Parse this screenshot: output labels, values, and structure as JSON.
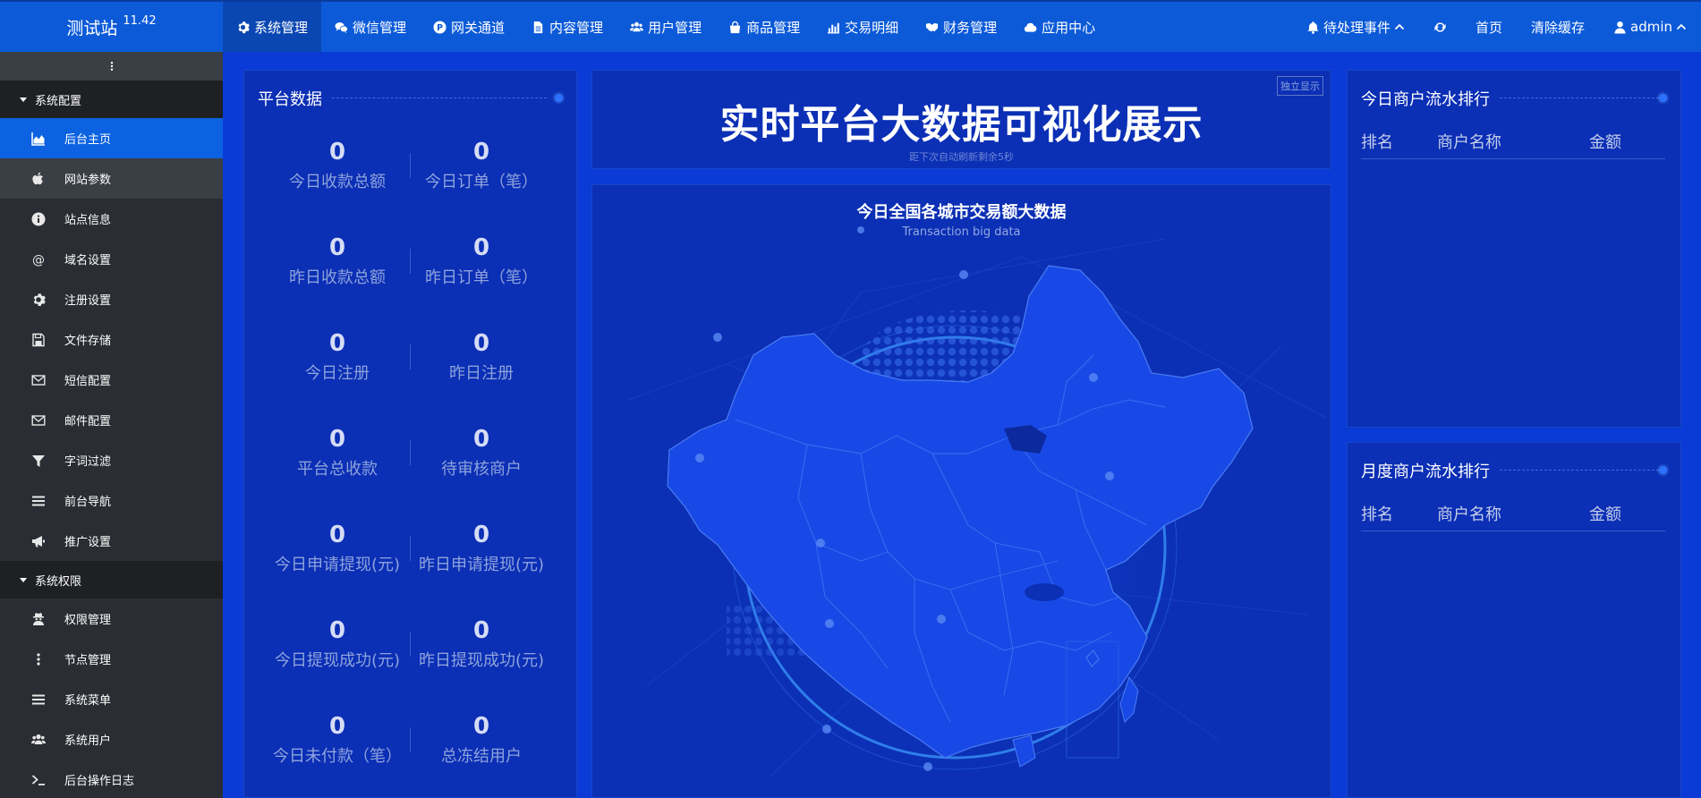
{
  "brand": {
    "name": "测试站",
    "version": "11.42"
  },
  "topnav": [
    {
      "label": "系统管理",
      "icon": "gear-icon",
      "active": true
    },
    {
      "label": "微信管理",
      "icon": "wechat-icon",
      "active": false
    },
    {
      "label": "网关通道",
      "icon": "paypal-icon",
      "active": false
    },
    {
      "label": "内容管理",
      "icon": "file-icon",
      "active": false
    },
    {
      "label": "用户管理",
      "icon": "users-icon",
      "active": false
    },
    {
      "label": "商品管理",
      "icon": "shopping-bag-icon",
      "active": false
    },
    {
      "label": "交易明细",
      "icon": "bar-chart-icon",
      "active": false
    },
    {
      "label": "财务管理",
      "icon": "handshake-icon",
      "active": false
    },
    {
      "label": "应用中心",
      "icon": "cloud-icon",
      "active": false
    }
  ],
  "topright": {
    "pending": "待处理事件",
    "home": "首页",
    "clear_cache": "清除缓存",
    "user": "admin"
  },
  "sidebar": {
    "groups": [
      {
        "label": "系统配置",
        "items": [
          {
            "label": "后台主页",
            "icon": "area-chart-icon",
            "state": "active"
          },
          {
            "label": "网站参数",
            "icon": "apple-icon",
            "state": "hover"
          },
          {
            "label": "站点信息",
            "icon": "info-circle-icon",
            "state": ""
          },
          {
            "label": "域名设置",
            "icon": "at-icon",
            "state": ""
          },
          {
            "label": "注册设置",
            "icon": "gear-icon",
            "state": ""
          },
          {
            "label": "文件存储",
            "icon": "floppy-icon",
            "state": ""
          },
          {
            "label": "短信配置",
            "icon": "envelope-icon",
            "state": ""
          },
          {
            "label": "邮件配置",
            "icon": "envelope-icon",
            "state": ""
          },
          {
            "label": "字词过滤",
            "icon": "filter-icon",
            "state": ""
          },
          {
            "label": "前台导航",
            "icon": "bars-icon",
            "state": ""
          },
          {
            "label": "推广设置",
            "icon": "bullhorn-icon",
            "state": ""
          }
        ]
      },
      {
        "label": "系统权限",
        "items": [
          {
            "label": "权限管理",
            "icon": "user-secret-icon",
            "state": ""
          },
          {
            "label": "节点管理",
            "icon": "ellipsis-vertical-icon",
            "state": ""
          },
          {
            "label": "系统菜单",
            "icon": "bars-icon",
            "state": ""
          },
          {
            "label": "系统用户",
            "icon": "users-icon",
            "state": ""
          },
          {
            "label": "后台操作日志",
            "icon": "terminal-icon",
            "state": ""
          }
        ]
      }
    ]
  },
  "platform": {
    "title": "平台数据",
    "stats": [
      {
        "value": "0",
        "label": "今日收款总额"
      },
      {
        "value": "0",
        "label": "今日订单（笔）"
      },
      {
        "value": "0",
        "label": "昨日收款总额"
      },
      {
        "value": "0",
        "label": "昨日订单（笔）"
      },
      {
        "value": "0",
        "label": "今日注册"
      },
      {
        "value": "0",
        "label": "昨日注册"
      },
      {
        "value": "0",
        "label": "平台总收款"
      },
      {
        "value": "0",
        "label": "待审核商户"
      },
      {
        "value": "0",
        "label": "今日申请提现(元)"
      },
      {
        "value": "0",
        "label": "昨日申请提现(元)"
      },
      {
        "value": "0",
        "label": "今日提现成功(元)"
      },
      {
        "value": "0",
        "label": "昨日提现成功(元)"
      },
      {
        "value": "0",
        "label": "今日未付款（笔）"
      },
      {
        "value": "0",
        "label": "总冻结用户"
      }
    ]
  },
  "header_panel": {
    "title": "实时平台大数据可视化展示",
    "refresh_note": "距下次自动刷新剩余5秒",
    "standalone": "独立显示"
  },
  "map_panel": {
    "title": "今日全国各城市交易额大数据",
    "subtitle": "Transaction big data"
  },
  "ranking_today": {
    "title": "今日商户流水排行",
    "columns": [
      "排名",
      "商户名称",
      "金额"
    ],
    "rows": []
  },
  "ranking_month": {
    "title": "月度商户流水排行",
    "columns": [
      "排名",
      "商户名称",
      "金额"
    ],
    "rows": []
  },
  "colors": {
    "accent": "#0c62e0",
    "topbar": "#0c5ad8",
    "sidebar": "#2a2d33",
    "panel": "#0b2fb5"
  }
}
